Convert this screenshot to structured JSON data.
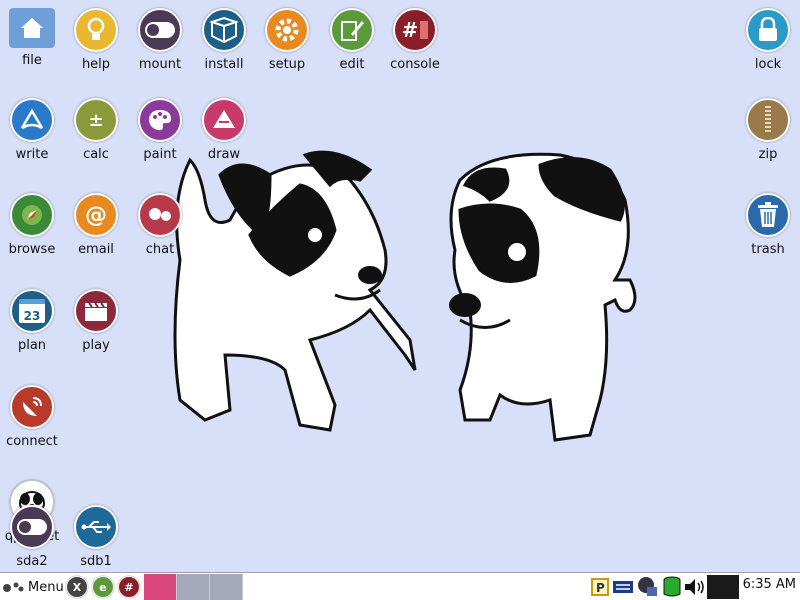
{
  "desktop": {
    "icons": {
      "file": "file",
      "help": "help",
      "mount": "mount",
      "install": "install",
      "setup": "setup",
      "edit": "edit",
      "console": "console",
      "lock": "lock",
      "write": "write",
      "calc": "calc",
      "paint": "paint",
      "draw": "draw",
      "zip": "zip",
      "browse": "browse",
      "email": "email",
      "chat": "chat",
      "trash": "trash",
      "plan": "plan",
      "play": "play",
      "connect": "connect",
      "qpupget": "qpupget",
      "sda2": "sda2",
      "sdb1": "sdb1"
    },
    "glyphs": {
      "console": "#",
      "calc": "±",
      "email": "@",
      "plan_day": "23"
    },
    "colors": {
      "background": "#d8dff8",
      "help": "#e8b830",
      "mount": "#4a3a55",
      "install": "#1d5f8a",
      "setup": "#e88a20",
      "edit": "#5a9a3a",
      "console": "#8a1f2a",
      "lock": "#2a9acb",
      "write": "#2a7acb",
      "calc": "#8a9a3a",
      "paint": "#8a3a9a",
      "draw": "#c83a6a",
      "zip": "#9a7a4a",
      "browse": "#3a8a3a",
      "email": "#e88a20",
      "chat": "#b83a4a",
      "trash": "#2a6aab",
      "plan": "#1d5f8a",
      "play": "#8a2a3a",
      "connect": "#b83a2a",
      "sdb1": "#1d6a9a"
    }
  },
  "taskbar": {
    "menu_label": "Menu",
    "clock": "6:35 AM",
    "launchers": [
      "X",
      "e",
      "#"
    ],
    "workspaces": [
      "1",
      "2",
      "3"
    ],
    "active_workspace": "1",
    "tray_icons": [
      "printer-icon",
      "network-icon",
      "update-icon",
      "storage-icon",
      "volume-icon",
      "blank-icon"
    ]
  }
}
